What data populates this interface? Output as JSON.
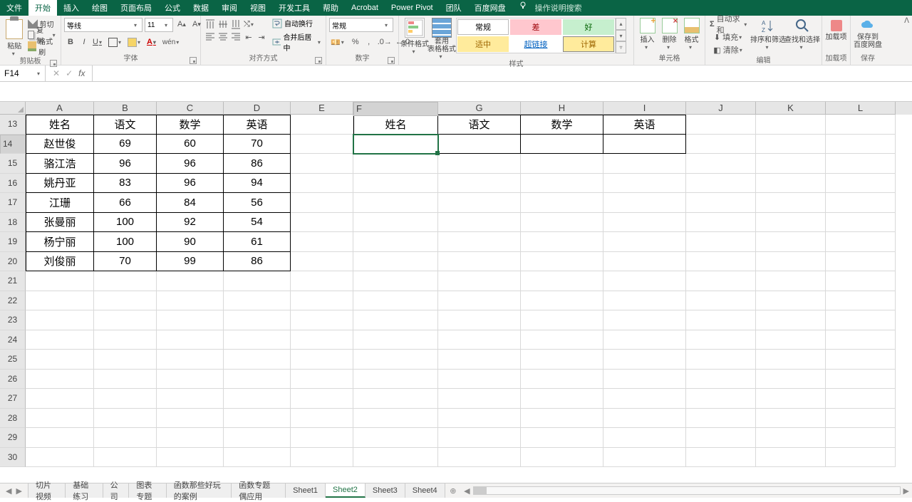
{
  "menu": {
    "file": "文件",
    "home": "开始",
    "insert": "插入",
    "draw": "绘图",
    "layout": "页面布局",
    "formula": "公式",
    "data": "数据",
    "review": "审阅",
    "view": "视图",
    "dev": "开发工具",
    "help": "帮助",
    "acrobat": "Acrobat",
    "powerpivot": "Power Pivot",
    "team": "团队",
    "baidu": "百度网盘",
    "tell": "操作说明搜索"
  },
  "ribbon": {
    "clipboard": {
      "paste": "粘贴",
      "cut": "剪切",
      "copy": "复制",
      "brush": "格式刷",
      "label": "剪贴板"
    },
    "font": {
      "name": "等线",
      "size": "11",
      "label": "字体"
    },
    "align": {
      "wrap": "自动换行",
      "merge": "合并后居中",
      "label": "对齐方式"
    },
    "number": {
      "format": "常规",
      "label": "数字"
    },
    "styles": {
      "cond": "条件格式",
      "table": "套用\n表格格式",
      "normal": "常规",
      "bad": "差",
      "good": "好",
      "neutral": "适中",
      "link": "超链接",
      "calc": "计算",
      "label": "样式"
    },
    "cells": {
      "insert": "插入",
      "delete": "删除",
      "format": "格式",
      "label": "单元格"
    },
    "editing": {
      "sum": "自动求和",
      "fill": "填充",
      "clear": "清除",
      "sort": "排序和筛选",
      "find": "查找和选择",
      "label": "编辑"
    },
    "addin": {
      "add": "加载项",
      "label": "加载项"
    },
    "save": {
      "save": "保存到\n百度网盘",
      "label": "保存"
    }
  },
  "namebox": "F14",
  "columns": [
    "A",
    "B",
    "C",
    "D",
    "E",
    "F",
    "G",
    "H",
    "I",
    "J",
    "K",
    "L"
  ],
  "rowStart": 13,
  "rowCount": 18,
  "table1": {
    "headers": [
      "姓名",
      "语文",
      "数学",
      "英语"
    ],
    "rows": [
      [
        "赵世俊",
        "69",
        "60",
        "70"
      ],
      [
        "骆江浩",
        "96",
        "96",
        "86"
      ],
      [
        "姚丹亚",
        "83",
        "96",
        "94"
      ],
      [
        "江珊",
        "66",
        "84",
        "56"
      ],
      [
        "张曼丽",
        "100",
        "92",
        "54"
      ],
      [
        "杨宁丽",
        "100",
        "90",
        "61"
      ],
      [
        "刘俊丽",
        "70",
        "99",
        "86"
      ]
    ]
  },
  "table2": {
    "headers": [
      "姓名",
      "语文",
      "数学",
      "英语"
    ]
  },
  "sheets": [
    "切片视频",
    "基础练习",
    "公司",
    "图表专题",
    "函数那些好玩的案例",
    "函数专题偶应用",
    "Sheet1",
    "Sheet2",
    "Sheet3",
    "Sheet4"
  ],
  "activeSheet": "Sheet2"
}
